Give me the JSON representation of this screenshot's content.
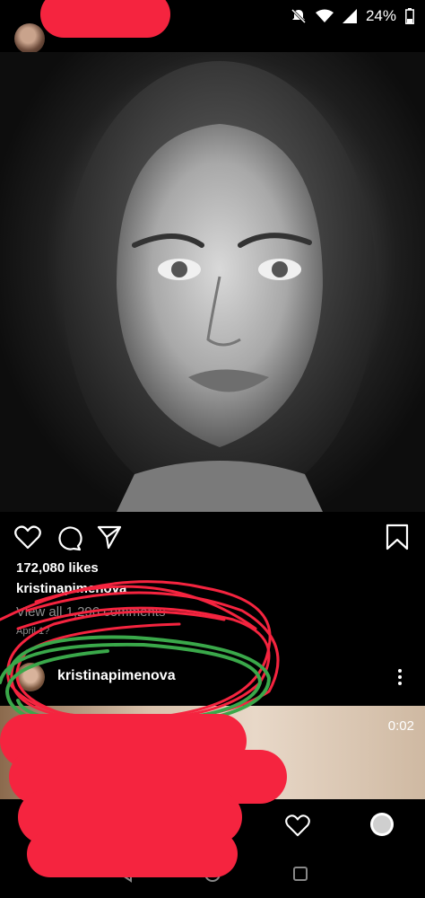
{
  "status_bar": {
    "battery": "24%",
    "icons": [
      "mute-icon",
      "wifi-icon",
      "signal-icon",
      "battery-icon"
    ]
  },
  "post": {
    "username_partial": "pimenova",
    "likes": "172,080 likes",
    "caption_user": "kristinapimenova",
    "view_comments": "View all 1,296 comments",
    "date": "April 1?"
  },
  "next_post": {
    "username": "kristinapimenova",
    "video_time": "0:02"
  },
  "colors": {
    "background": "#000000",
    "secondary_text": "#8e8e8e",
    "red_marker": "#f5243f",
    "green_marker": "#3aa84a"
  }
}
